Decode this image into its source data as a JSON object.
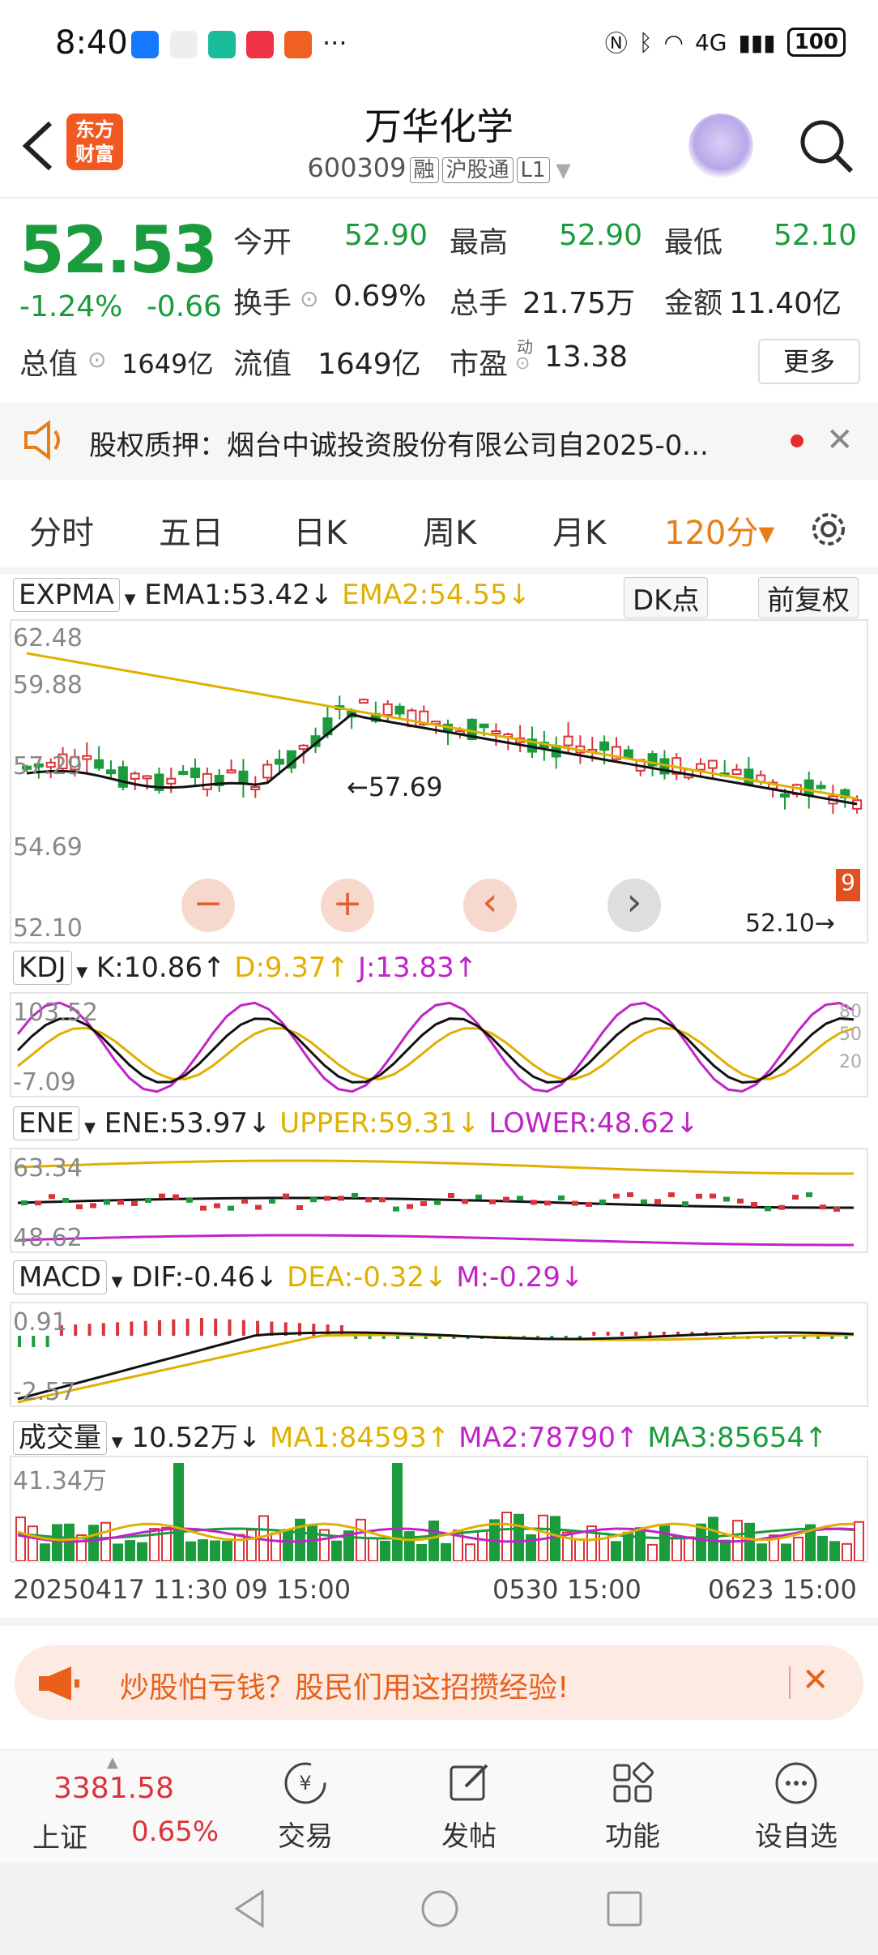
{
  "status": {
    "time": "8:40",
    "network": "4G",
    "battery": "100",
    "more": "···"
  },
  "header": {
    "logo_line1": "东方",
    "logo_line2": "财富",
    "name": "万华化学",
    "code": "600309",
    "tags": [
      "融",
      "沪股通",
      "L1"
    ]
  },
  "quote": {
    "price": "52.53",
    "change_pct": "-1.24%",
    "change": "-0.66",
    "open_label": "今开",
    "open": "52.90",
    "high_label": "最高",
    "high": "52.90",
    "low_label": "最低",
    "low": "52.10",
    "turnover_label": "换手",
    "turnover": "0.69%",
    "volume_label": "总手",
    "volume": "21.75万",
    "amount_label": "金额",
    "amount": "11.40亿",
    "mktcap_label": "总值",
    "mktcap": "1649亿",
    "float_label": "流值",
    "float": "1649亿",
    "pe_label": "市盈",
    "pe_sup": "动",
    "pe": "13.38",
    "more": "更多"
  },
  "notice": {
    "text": "股权质押：烟台中诚投资股份有限公司自2025-0...",
    "close": "✕"
  },
  "tabs": [
    {
      "label": "分时"
    },
    {
      "label": "五日"
    },
    {
      "label": "日K"
    },
    {
      "label": "周K"
    },
    {
      "label": "月K"
    },
    {
      "label": "120分▾"
    }
  ],
  "main_chart": {
    "indicator": "EXPMA",
    "ema1": "EMA1:53.42↓",
    "ema2": "EMA2:54.55↓",
    "dk": "DK点",
    "adjust": "前复权",
    "y_ticks": [
      "62.48",
      "59.88",
      "57.29",
      "54.69",
      "52.10"
    ],
    "annot_high": "←57.69",
    "annot_low": "52.10→",
    "signal_badge": "9",
    "nav_minus": "−",
    "nav_plus": "+",
    "nav_prev": "‹",
    "nav_next": "›"
  },
  "kdj": {
    "name": "KDJ",
    "k": "K:10.86↑",
    "d": "D:9.37↑",
    "j": "J:13.83↑",
    "y_top": "103.52",
    "y_bot": "-7.09",
    "r80": "80",
    "r50": "50",
    "r20": "20"
  },
  "ene": {
    "name": "ENE",
    "ene": "ENE:53.97↓",
    "upper": "UPPER:59.31↓",
    "lower": "LOWER:48.62↓",
    "y_top": "63.34",
    "y_bot": "48.62"
  },
  "macd": {
    "name": "MACD",
    "dif": "DIF:-0.46↓",
    "dea": "DEA:-0.32↓",
    "m": "M:-0.29↓",
    "y_top": "0.91",
    "y_bot": "-2.57"
  },
  "vol": {
    "name": "成交量",
    "value": "10.52万↓",
    "ma1": "MA1:84593↑",
    "ma2": "MA2:78790↑",
    "ma3": "MA3:85654↑",
    "y_top": "41.34万"
  },
  "x_axis": {
    "d1": "20250417 11:30",
    "d1b": "09 15:00",
    "d2": "0530 15:00",
    "d3": "0623 15:00"
  },
  "ad": {
    "text": "炒股怕亏钱？股民们用这招攒经验!",
    "close": "✕"
  },
  "bottom": {
    "index_value": "3381.58",
    "index_name": "上证",
    "index_change": "0.65%",
    "items": [
      {
        "label": "交易"
      },
      {
        "label": "发帖"
      },
      {
        "label": "功能"
      },
      {
        "label": "设自选"
      }
    ]
  },
  "colors": {
    "up": "#d9343a",
    "down": "#1a9b3c",
    "ema2": "#e0b000",
    "accent": "#e87e17"
  }
}
